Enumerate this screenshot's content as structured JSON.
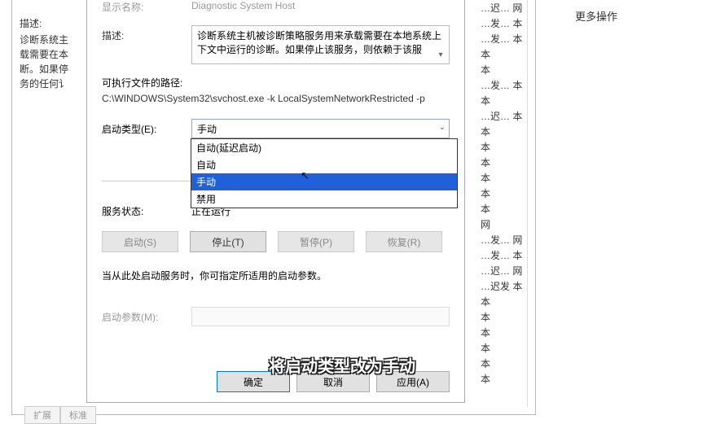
{
  "left": {
    "title": "描述:",
    "text": "诊断系统主\n载需要在本\n断。如果停\n务的任何讠"
  },
  "right": {
    "more_ops": "更多操作"
  },
  "bg": {
    "rows": [
      "…迟…  网",
      "…发…  本",
      "…发…  本",
      "        本",
      "        本",
      "…发…  本",
      "        本",
      "…迟…  本",
      "        本",
      "        本",
      "        本",
      "        本",
      "        本",
      "        本",
      "        网",
      "…发…  网",
      "…发…  本",
      "…迟…  网",
      "…迟发  本",
      "        本",
      "        本",
      "        本",
      "        本",
      "        本",
      "        本"
    ]
  },
  "dialog": {
    "display_name_label": "显示名称:",
    "display_name_value": "Diagnostic System Host",
    "desc_label": "描述:",
    "desc_text": "诊断系统主机被诊断策略服务用来承载需要在本地系统上下文中运行的诊断。如果停止该服务，则依赖于该服",
    "exec_label": "可执行文件的路径:",
    "exec_value": "C:\\WINDOWS\\System32\\svchost.exe -k LocalSystemNetworkRestricted -p",
    "startup_label": "启动类型(E):",
    "startup_value": "手动",
    "dropdown": {
      "opt1": "自动(延迟启动)",
      "opt2": "自动",
      "opt3": "手动",
      "opt4": "禁用"
    },
    "status_label": "服务状态:",
    "status_value": "正在运行",
    "buttons": {
      "start": "启动(S)",
      "stop": "停止(T)",
      "pause": "暂停(P)",
      "resume": "恢复(R)"
    },
    "hint": "当从此处启动服务时，你可指定所适用的启动参数。",
    "params_label": "启动参数(M):",
    "bottom": {
      "ok": "确定",
      "cancel": "取消",
      "apply": "应用(A)"
    }
  },
  "caption": "将启动类型改为手动",
  "tabs": {
    "t1": "扩展",
    "t2": "标准"
  }
}
